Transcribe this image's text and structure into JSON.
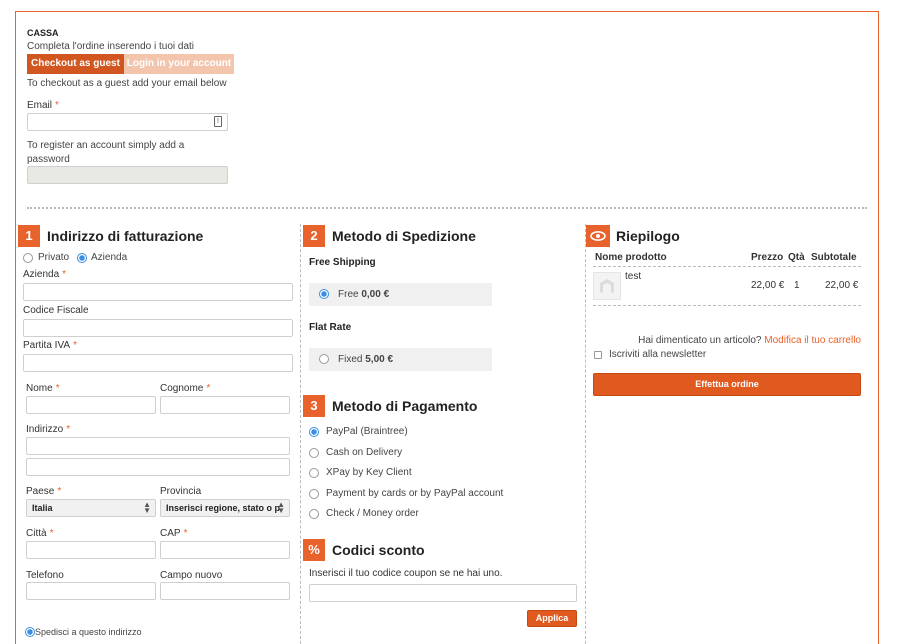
{
  "checkout": {
    "title": "CASSA",
    "subtitle": "Completa l'ordine inserendo i tuoi dati",
    "tab_guest": "Checkout as guest",
    "tab_login": "Login in your account",
    "guest_hint": "To checkout as a guest add your email below",
    "email_label": "Email",
    "register_hint_1": "To register an account simply add a",
    "register_hint_2": "password",
    "required_mark": "*"
  },
  "billing": {
    "number": "1",
    "title": "Indirizzo di fatturazione",
    "type_private": "Privato",
    "type_company": "Azienda",
    "selected_type": "Azienda",
    "company_label": "Azienda",
    "tax_code_label": "Codice Fiscale",
    "vat_label": "Partita IVA",
    "firstname_label": "Nome",
    "lastname_label": "Cognome",
    "address_label": "Indirizzo",
    "country_label": "Paese",
    "country_value": "Italia",
    "province_label": "Provincia",
    "province_value": "Inserisci regione, stato o p",
    "city_label": "Città",
    "zip_label": "CAP",
    "phone_label": "Telefono",
    "new_field_label": "Campo nuovo",
    "ship_here": "Spedisci a questo indirizzo"
  },
  "shipping": {
    "number": "2",
    "title": "Metodo di Spedizione",
    "methods": [
      {
        "carrier": "Free Shipping",
        "label": "Free",
        "price": "0,00 €",
        "selected": true
      },
      {
        "carrier": "Flat Rate",
        "label": "Fixed",
        "price": "5,00 €",
        "selected": false
      }
    ]
  },
  "payment": {
    "number": "3",
    "title": "Metodo di Pagamento",
    "options": [
      {
        "label": "PayPal (Braintree)",
        "selected": true
      },
      {
        "label": "Cash on Delivery",
        "selected": false
      },
      {
        "label": "XPay by Key Client",
        "selected": false
      },
      {
        "label": "Payment by cards or by PayPal account",
        "selected": false
      },
      {
        "label": "Check / Money order",
        "selected": false
      }
    ]
  },
  "discount": {
    "icon_text": "%",
    "title": "Codici sconto",
    "hint": "Inserisci il tuo codice coupon se ne hai uno.",
    "apply_label": "Applica"
  },
  "summary": {
    "title": "Riepilogo",
    "headers": {
      "name": "Nome prodotto",
      "price": "Prezzo",
      "qty": "Qtà",
      "subtotal": "Subtotale"
    },
    "items": [
      {
        "name": "test",
        "price": "22,00 €",
        "qty": "1",
        "subtotal": "22,00 €"
      }
    ],
    "forgot_text": "Hai dimenticato un articolo?",
    "edit_cart_link": "Modifica il tuo carrello",
    "newsletter_label": "Iscriviti alla newsletter",
    "place_order_label": "Effettua ordine"
  },
  "colors": {
    "accent": "#e8622c",
    "link": "#e8622c",
    "radio_selected": "#3b8ee3"
  }
}
